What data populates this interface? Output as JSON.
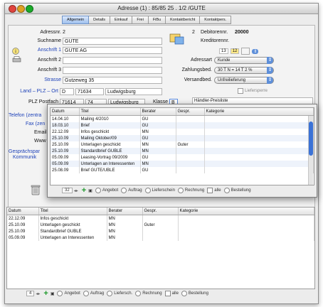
{
  "window": {
    "title": "Adresse (1) : 85/85 25 . 1/2 /GUTE"
  },
  "tabs": [
    "Allgemein",
    "Details",
    "Einkauf",
    "Frei",
    "FiBu",
    "Kontaktbericht",
    "Kontaktpers."
  ],
  "form": {
    "adressnr_label": "Adressnr.",
    "adressnr_value": "2",
    "suchname_label": "Suchname",
    "suchname_value": "GUTE",
    "anschrift1_label": "Anschrift 1",
    "anschrift1_value": "GUTE AG",
    "anschrift2_label": "Anschrift 2",
    "anschrift3_label": "Anschrift 3",
    "strasse_label": "Strasse",
    "strasse_value": "Gutzeweg 35",
    "land_label": "Land – PLZ – Ort",
    "land_value": "D",
    "plz_value": "71634",
    "ort_value": "Ludwigsburg",
    "postfach_label": "PLZ Postfach",
    "postfach_value": "71614",
    "postfach_nr": "74",
    "postfach_ort": "Ludwigsburg",
    "klasse_label": "Klasse",
    "klasse_value": "B",
    "debitor_num": "2",
    "debitor_label": "Debitorennr.",
    "debitor_value": "20000",
    "kreditor_label": "Kreditorennr.",
    "adressart_label": "Adressart",
    "adressart_value": "Kunde",
    "zahlung_label": "Zahlungsbed.",
    "zahlung_value": "30 T N = 14 T 2 %",
    "versand_label": "Versandbed.",
    "versand_value": "Unfreilieferung",
    "lieferspere_label": "Liefersperre",
    "haendler_label": "Händler-Preisliste",
    "counter1": "13",
    "counter2": "12"
  },
  "side_links": {
    "telefon": "Telefon (zentra",
    "fax": "Fax (zen",
    "email": "Email",
    "www": "Www",
    "gespraech": "Gesprächspar",
    "kommunik": "Kommunik"
  },
  "popup": {
    "columns": [
      "Datum",
      "Titel",
      "Berater",
      "Gespr.",
      "Kategorie"
    ],
    "rows": [
      [
        "14.04.10",
        "Mailing 4/2010",
        "GU",
        "",
        ""
      ],
      [
        "18.03.10",
        "Brief",
        "GU",
        "",
        ""
      ],
      [
        "22.12.09",
        "Infos geschickt",
        "MN",
        "",
        ""
      ],
      [
        "25.10.09",
        "Mailing Oktober/09",
        "GU",
        "",
        ""
      ],
      [
        "25.10.09",
        "Unterlagen geschickt",
        "MN",
        "Guter",
        ""
      ],
      [
        "25.10.09",
        "Standardbrief GUBLE",
        "MN",
        "",
        ""
      ],
      [
        "05.09.09",
        "Leasing-Vortrag 09/2009",
        "GU",
        "",
        ""
      ],
      [
        "05.09.09",
        "Unterlagen an Interessenten",
        "MN",
        "",
        ""
      ],
      [
        "25.08.09",
        "Brief GUTE/UBLE",
        "GU",
        "",
        ""
      ]
    ],
    "count": "32",
    "options": [
      "Angebot",
      "Auftrag",
      "Lieferschein",
      "Rechnung",
      "alle",
      "Bestellung"
    ]
  },
  "bottom_table": {
    "columns": [
      "Datum",
      "Titel",
      "Berater",
      "Gespr.",
      "Kategorie"
    ],
    "rows": [
      [
        "22.12.09",
        "Infos geschickt",
        "MN",
        "",
        ""
      ],
      [
        "25.10.09",
        "Unterlagen geschickt",
        "MN",
        "Guter",
        ""
      ],
      [
        "25.10.09",
        "Standardbrief GUBLE",
        "MN",
        "",
        ""
      ],
      [
        "05.09.09",
        "Unterlagen an Interessenten",
        "MN",
        "",
        ""
      ]
    ],
    "count": "4",
    "options": [
      "Angebot",
      "Auftrag",
      "Liefersch.",
      "Rechnung",
      "alle",
      "Bestellung"
    ]
  },
  "icons": {
    "close": "close-icon",
    "minimize": "minimize-icon",
    "zoom": "zoom-icon",
    "trash": "trash-icon",
    "add": "plus-icon",
    "colors": {
      "close": "#e0443e",
      "minimize": "#dea123",
      "zoom": "#1aab29",
      "link": "#1d41b8",
      "tab_active": "#9fc0ee"
    }
  }
}
